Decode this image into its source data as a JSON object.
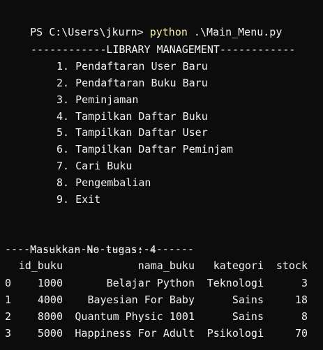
{
  "prompt": {
    "ps_prefix": "PS C:\\Users\\jkurn> ",
    "command": "python",
    "argument": " .\\Main_Menu.py"
  },
  "menu": {
    "header": "------------LIBRARY MANAGEMENT------------",
    "items": [
      "1. Pendaftaran User Baru",
      "2. Pendaftaran Buku Baru",
      "3. Peminjaman",
      "4. Tampilkan Daftar Buku",
      "5. Tampilkan Daftar User",
      "6. Tampilkan Daftar Peminjam",
      "7. Cari Buku",
      "8. Pengembalian",
      "9. Exit"
    ]
  },
  "input": {
    "label": "Masukkan No tugas: ",
    "value": "4"
  },
  "separator": "------------------------------",
  "table": {
    "columns": [
      "",
      "id_buku",
      "nama_buku",
      "kategori",
      "stock"
    ],
    "rows": [
      {
        "idx": "0",
        "id_buku": "1000",
        "nama_buku": "Belajar Python",
        "kategori": "Teknologi",
        "stock": "3"
      },
      {
        "idx": "1",
        "id_buku": "4000",
        "nama_buku": "Bayesian For Baby",
        "kategori": "Sains",
        "stock": "18"
      },
      {
        "idx": "2",
        "id_buku": "8000",
        "nama_buku": "Quantum Physic 1001",
        "kategori": "Sains",
        "stock": "8"
      },
      {
        "idx": "3",
        "id_buku": "5000",
        "nama_buku": "Happiness For Adult",
        "kategori": "Psikologi",
        "stock": "70"
      }
    ]
  },
  "colors": {
    "background": "#0c0c0c",
    "text": "#f2f2f2",
    "command": "#f9f1a5"
  }
}
